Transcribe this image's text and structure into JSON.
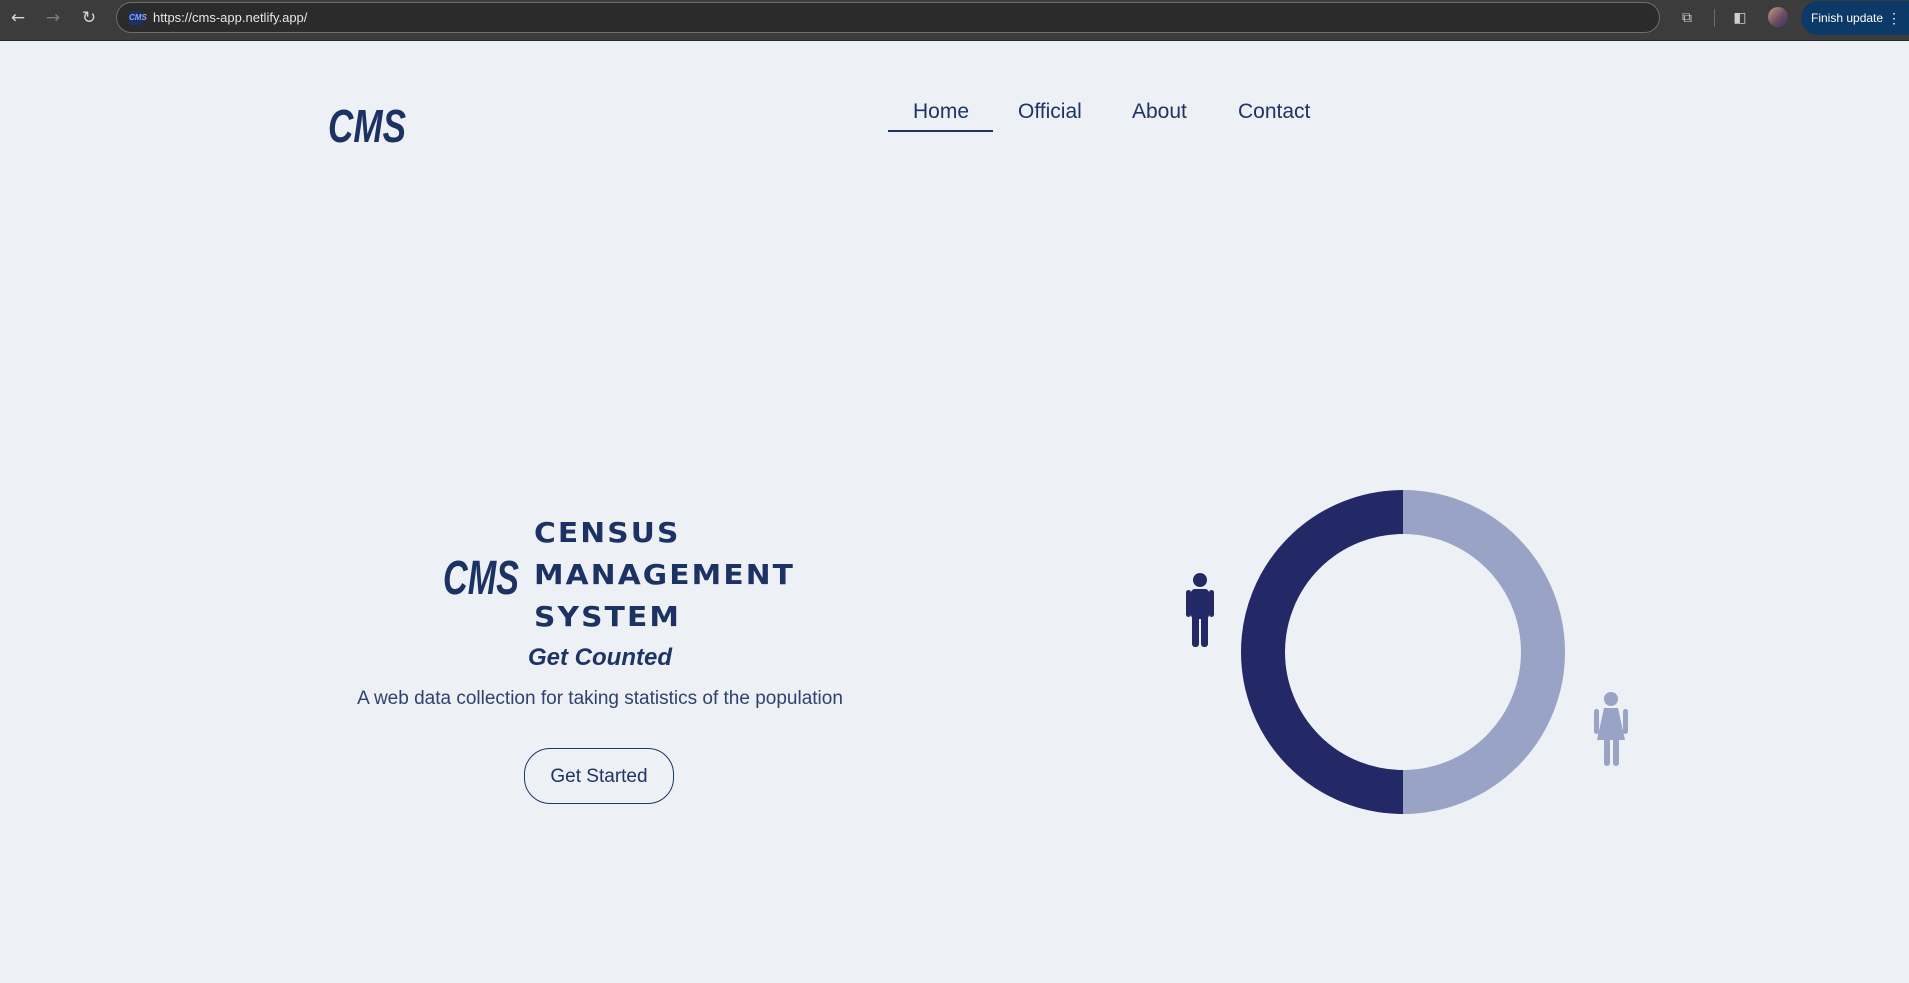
{
  "browser": {
    "url": "https://cms-app.netlify.app/",
    "site_icon_text": "CMS",
    "update_button": "Finish update"
  },
  "brand": {
    "logo_text": "CMS"
  },
  "nav": {
    "items": [
      {
        "label": "Home",
        "active": true
      },
      {
        "label": "Official",
        "active": false
      },
      {
        "label": "About",
        "active": false
      },
      {
        "label": "Contact",
        "active": false
      }
    ]
  },
  "hero": {
    "logo_text": "CMS",
    "title_lines": [
      "CENSUS",
      "MANAGEMENT",
      "SYSTEM"
    ],
    "tagline": "Get Counted",
    "description": "A web data collection for taking statistics of the population",
    "cta_label": "Get Started"
  },
  "donut": {
    "segments": [
      {
        "icon": "male-person-icon",
        "fraction": 0.5,
        "color": "#232866"
      },
      {
        "icon": "female-person-icon",
        "fraction": 0.5,
        "color": "#98a3c6"
      }
    ]
  },
  "colors": {
    "brand": "#1b3263",
    "background": "#edf0f4",
    "male": "#232866",
    "female": "#98a3c6"
  }
}
